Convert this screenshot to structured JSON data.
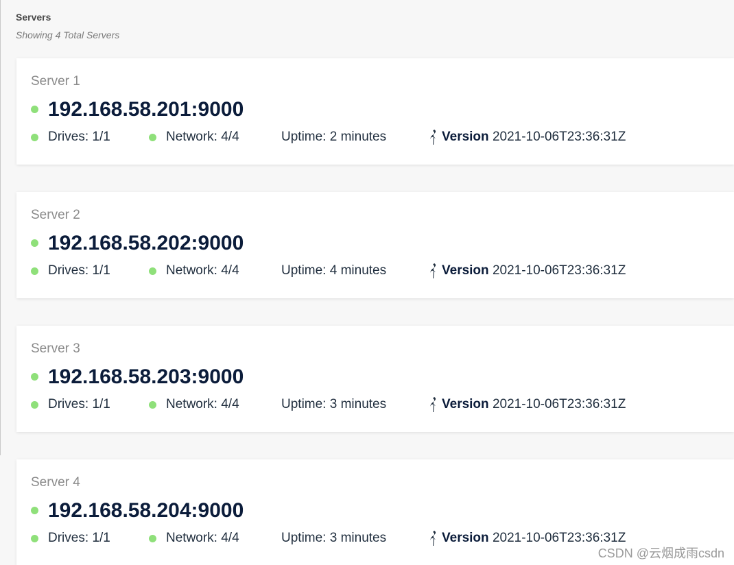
{
  "header": {
    "title": "Servers",
    "subtitle": "Showing 4 Total Servers"
  },
  "servers": [
    {
      "name": "Server 1",
      "address": "192.168.58.201:9000",
      "drives": "Drives: 1/1",
      "network": "Network: 4/4",
      "uptime": "Uptime: 2 minutes",
      "version_label": "Version",
      "version_value": "2021-10-06T23:36:31Z"
    },
    {
      "name": "Server 2",
      "address": "192.168.58.202:9000",
      "drives": "Drives: 1/1",
      "network": "Network: 4/4",
      "uptime": "Uptime: 4 minutes",
      "version_label": "Version",
      "version_value": "2021-10-06T23:36:31Z"
    },
    {
      "name": "Server 3",
      "address": "192.168.58.203:9000",
      "drives": "Drives: 1/1",
      "network": "Network: 4/4",
      "uptime": "Uptime: 3 minutes",
      "version_label": "Version",
      "version_value": "2021-10-06T23:36:31Z"
    },
    {
      "name": "Server 4",
      "address": "192.168.58.204:9000",
      "drives": "Drives: 1/1",
      "network": "Network: 4/4",
      "uptime": "Uptime: 3 minutes",
      "version_label": "Version",
      "version_value": "2021-10-06T23:36:31Z"
    }
  ],
  "colors": {
    "status_online": "#8fe07a",
    "address_text": "#0b1c3a",
    "card_background": "#ffffff",
    "page_background": "#f7f7f7"
  },
  "icons": {
    "version": "minio-bird-icon",
    "status": "status-dot-icon"
  },
  "watermark": "CSDN @云烟成雨csdn"
}
